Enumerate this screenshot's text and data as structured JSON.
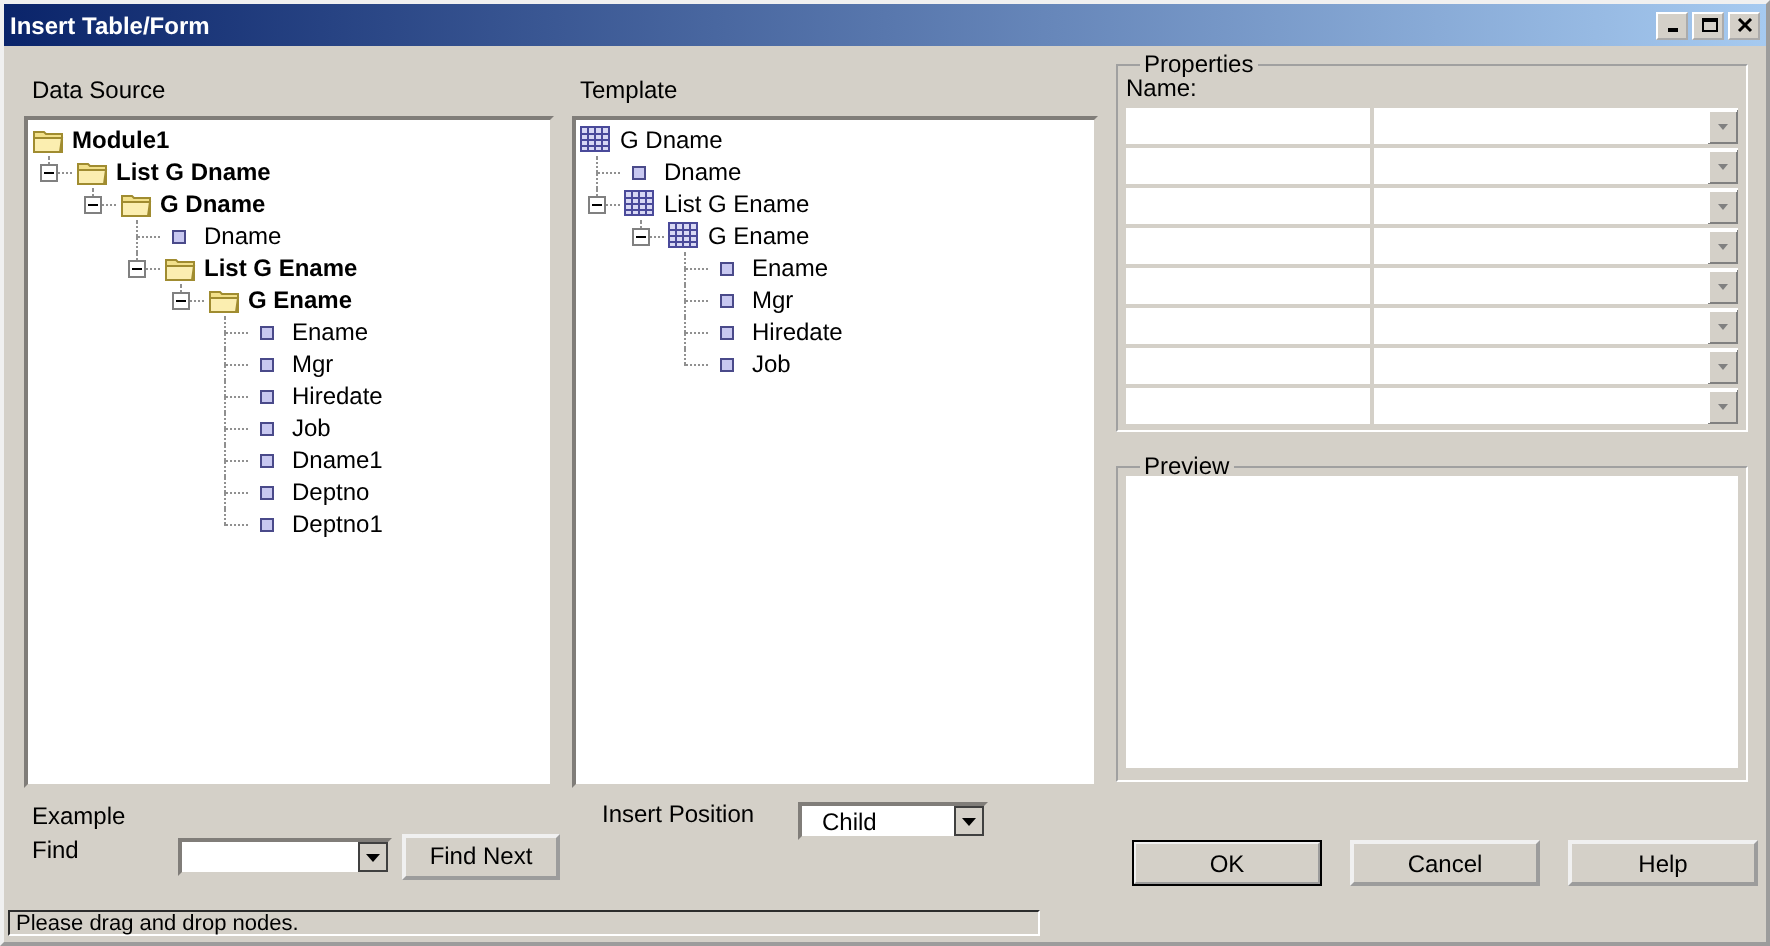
{
  "window": {
    "title": "Insert Table/Form",
    "controls": [
      {
        "kind": "minimize"
      },
      {
        "kind": "maximize"
      },
      {
        "kind": "close"
      }
    ]
  },
  "data_source": {
    "label": "Data Source",
    "tree": [
      {
        "label": "Module1",
        "kind": "folder",
        "children": [
          {
            "label": "List G Dname",
            "kind": "folder",
            "expanded": true,
            "children": [
              {
                "label": "G Dname",
                "kind": "folder",
                "expanded": true,
                "children": [
                  {
                    "label": "Dname",
                    "kind": "field"
                  },
                  {
                    "label": "List G Ename",
                    "kind": "folder",
                    "expanded": true,
                    "children": [
                      {
                        "label": "G Ename",
                        "kind": "folder",
                        "expanded": true,
                        "children": [
                          {
                            "label": "Ename",
                            "kind": "field"
                          },
                          {
                            "label": "Mgr",
                            "kind": "field"
                          },
                          {
                            "label": "Hiredate",
                            "kind": "field"
                          },
                          {
                            "label": "Job",
                            "kind": "field"
                          },
                          {
                            "label": "Dname1",
                            "kind": "field"
                          },
                          {
                            "label": "Deptno",
                            "kind": "field"
                          },
                          {
                            "label": "Deptno1",
                            "kind": "field"
                          }
                        ]
                      }
                    ]
                  }
                ]
              }
            ]
          }
        ]
      }
    ]
  },
  "template": {
    "label": "Template",
    "tree": [
      {
        "label": "G Dname",
        "kind": "table",
        "children": [
          {
            "label": "Dname",
            "kind": "field"
          },
          {
            "label": "List G Ename",
            "kind": "table",
            "expanded": true,
            "children": [
              {
                "label": "G Ename",
                "kind": "table",
                "expanded": true,
                "children": [
                  {
                    "label": "Ename",
                    "kind": "field"
                  },
                  {
                    "label": "Mgr",
                    "kind": "field"
                  },
                  {
                    "label": "Hiredate",
                    "kind": "field"
                  },
                  {
                    "label": "Job",
                    "kind": "field"
                  }
                ]
              }
            ]
          }
        ]
      }
    ]
  },
  "properties": {
    "title": "Properties",
    "name_label": "Name:",
    "rows": [
      {
        "kind": "dropdown"
      },
      {
        "kind": "dropdown"
      },
      {
        "kind": "dropdown"
      },
      {
        "kind": "dropdown"
      },
      {
        "kind": "dropdown"
      },
      {
        "kind": "dropdown"
      },
      {
        "kind": "dropdown"
      },
      {
        "kind": "dropdown"
      }
    ]
  },
  "preview": {
    "title": "Preview"
  },
  "example_label": "Example",
  "find": {
    "label": "Find",
    "button": "Find Next"
  },
  "insert_position": {
    "label": "Insert Position",
    "value": "Child"
  },
  "buttons": [
    {
      "label": "OK",
      "default": true
    },
    {
      "label": "Cancel",
      "default": false
    },
    {
      "label": "Help",
      "default": false
    }
  ],
  "status_bar": "Please drag and drop nodes."
}
